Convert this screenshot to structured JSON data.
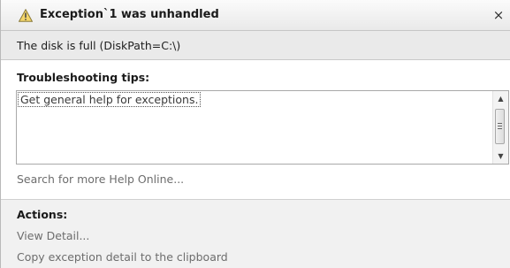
{
  "dialog": {
    "title": "Exception`1 was unhandled",
    "close_glyph": "×",
    "icon": "warning-triangle-icon",
    "message": "The disk is full (DiskPath=C:\\)"
  },
  "troubleshooting": {
    "heading": "Troubleshooting tips:",
    "tips": [
      "Get general help for exceptions."
    ],
    "search_link": "Search for more Help Online..."
  },
  "actions": {
    "heading": "Actions:",
    "items": [
      "View Detail...",
      "Copy exception detail to the clipboard"
    ]
  }
}
